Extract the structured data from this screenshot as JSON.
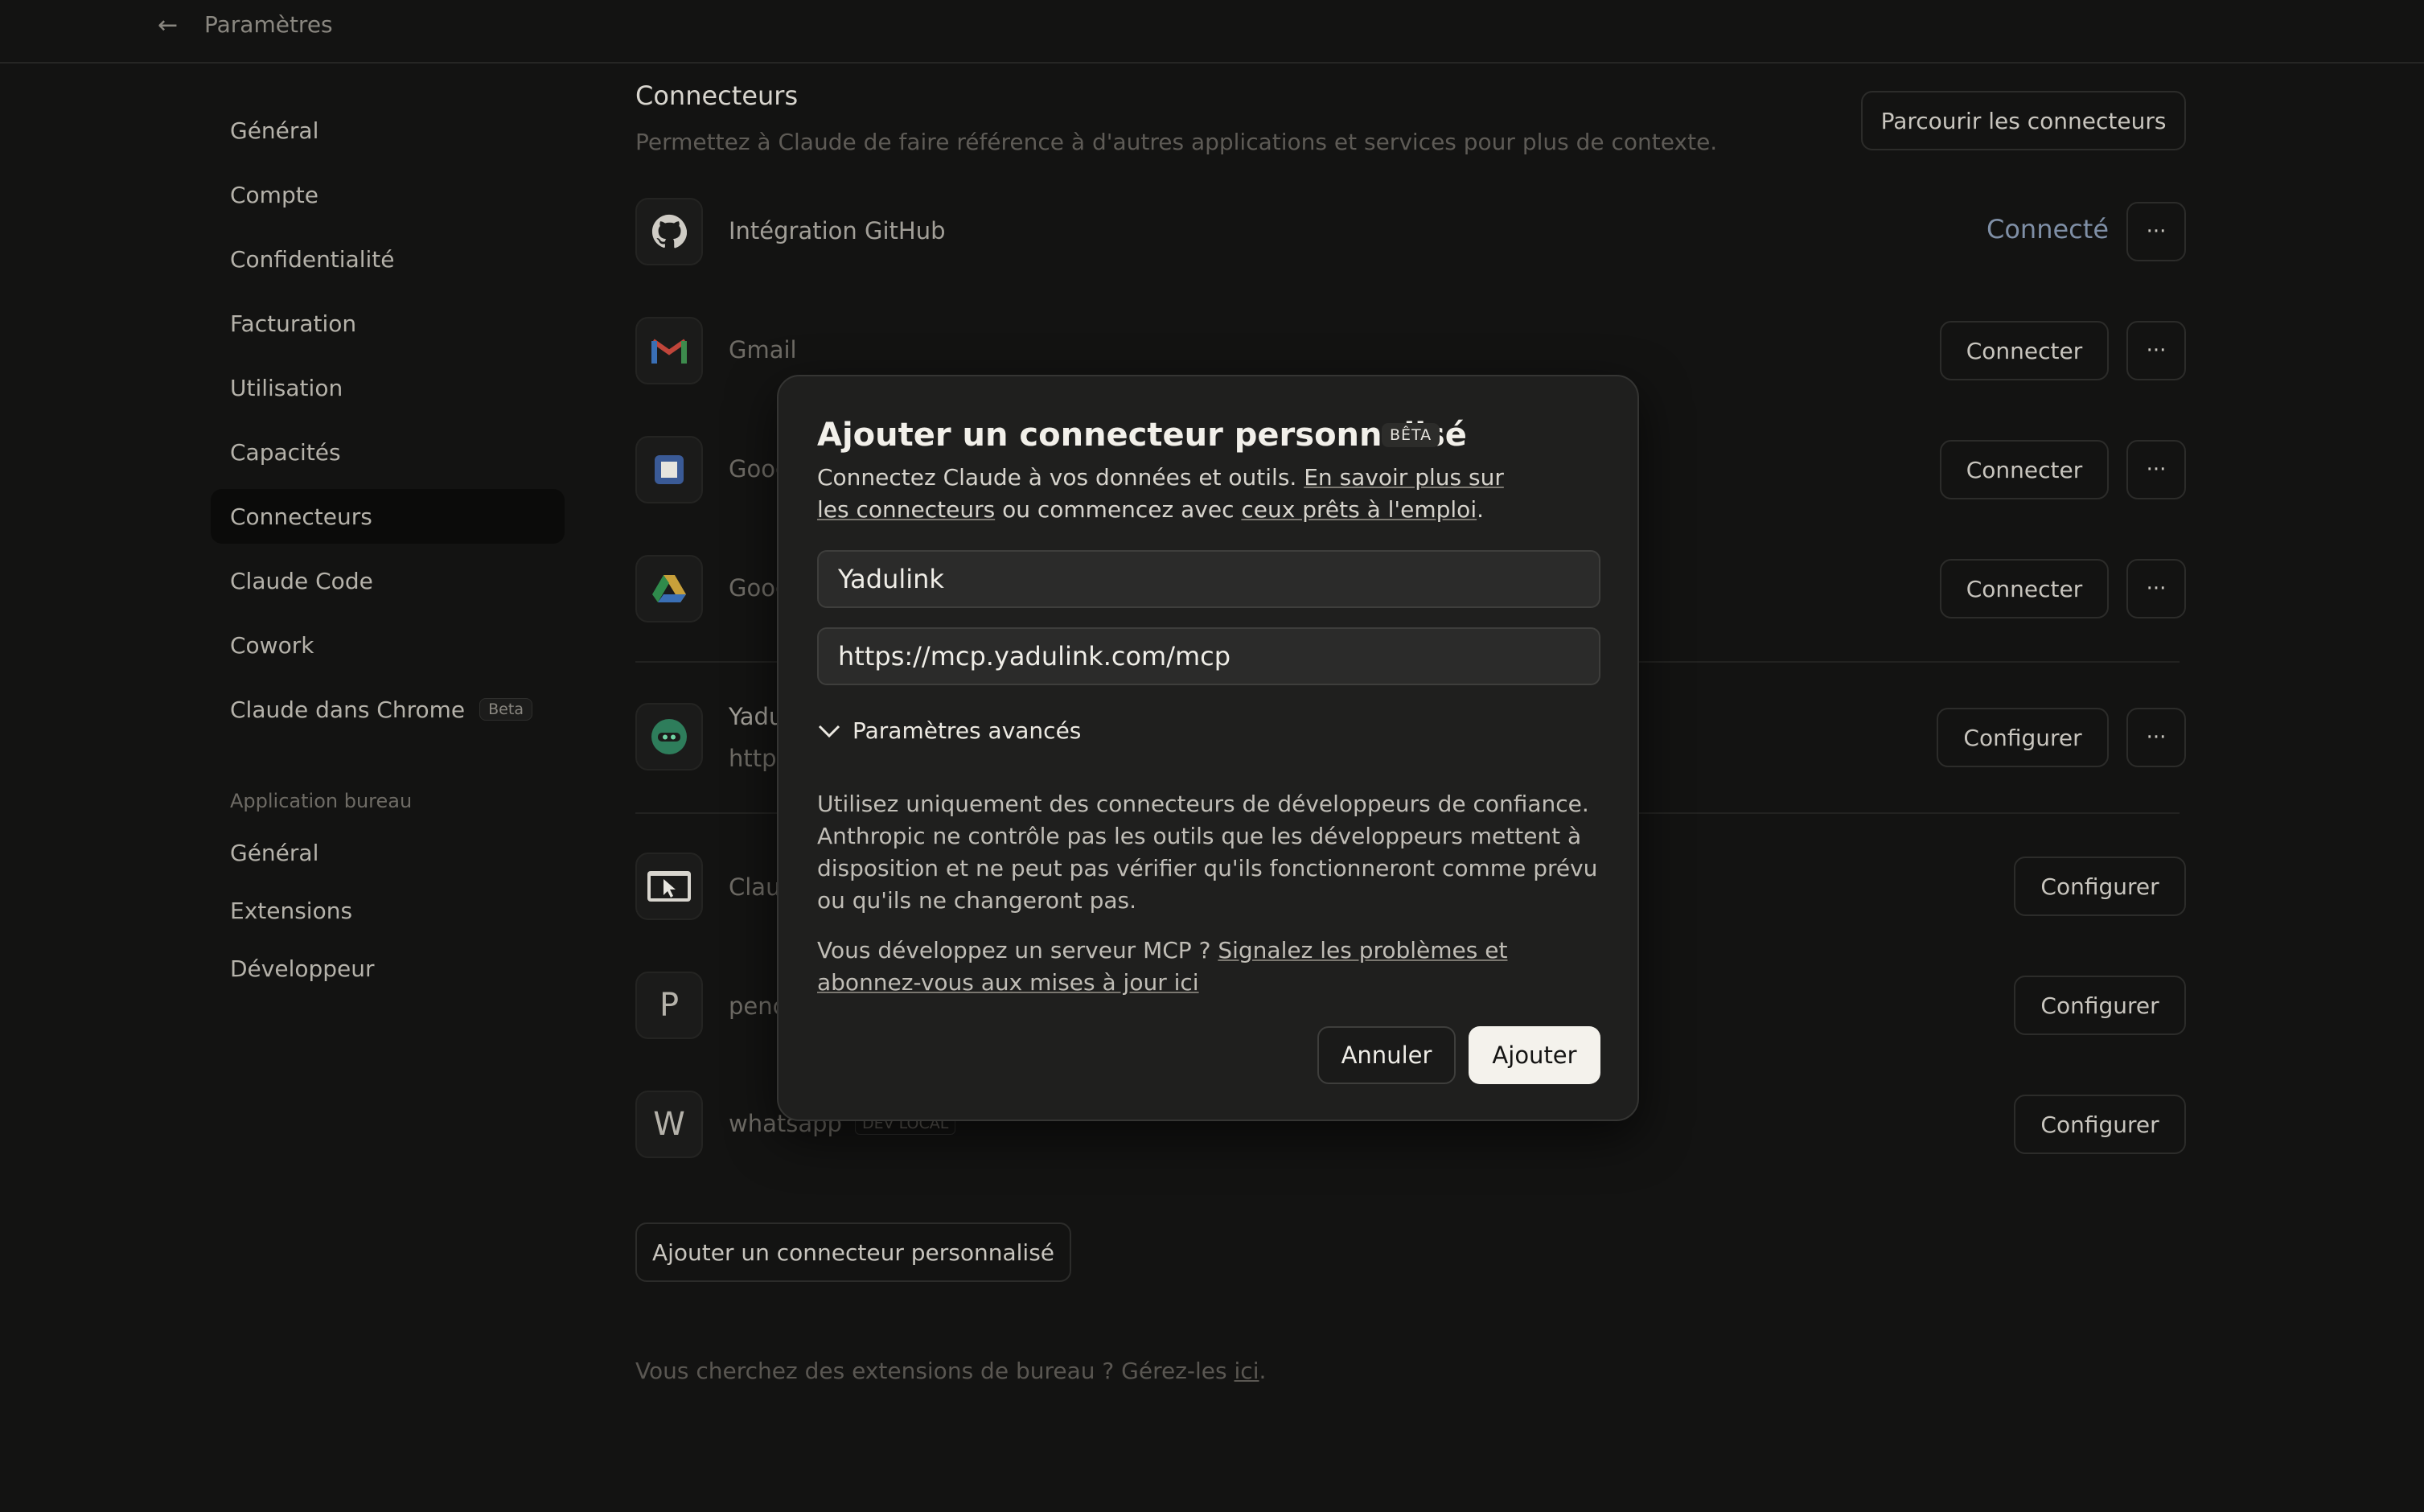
{
  "header": {
    "back_label": "Paramètres"
  },
  "sidebar": {
    "items": [
      {
        "label": "Général"
      },
      {
        "label": "Compte"
      },
      {
        "label": "Confidentialité"
      },
      {
        "label": "Facturation"
      },
      {
        "label": "Utilisation"
      },
      {
        "label": "Capacités"
      },
      {
        "label": "Connecteurs",
        "active": true
      },
      {
        "label": "Claude Code"
      },
      {
        "label": "Cowork"
      },
      {
        "label": "Claude dans Chrome",
        "badge": "Beta"
      }
    ],
    "section_title": "Application bureau",
    "desktop_items": [
      {
        "label": "Général"
      },
      {
        "label": "Extensions"
      },
      {
        "label": "Développeur"
      }
    ]
  },
  "main": {
    "title": "Connecteurs",
    "subtitle": "Permettez à Claude de faire référence à d'autres applications et services pour plus de contexte.",
    "browse_button": "Parcourir les connecteurs",
    "connectors": [
      {
        "name": "Intégration GitHub",
        "status": "Connecté",
        "icon": "github-icon"
      },
      {
        "name": "Gmail",
        "action": "Connecter",
        "icon": "gmail-icon"
      },
      {
        "name": "Goog",
        "action": "Connecter",
        "icon": "google-calendar-icon"
      },
      {
        "name": "Goog",
        "action": "Connecter",
        "icon": "google-drive-icon"
      },
      {
        "name": "Yadu",
        "url": "https",
        "action": "Configurer",
        "icon": "yadulink-icon"
      },
      {
        "name": "Clau",
        "action": "Configurer",
        "icon": "cursor-window-icon"
      },
      {
        "name": "penc",
        "action": "Configurer",
        "icon_letter": "P"
      },
      {
        "name": "whatsapp",
        "tag": "DEV LOCAL",
        "action": "Configurer",
        "icon_letter": "W"
      }
    ],
    "add_custom_button": "Ajouter un connecteur personnalisé",
    "footer_text": "Vous cherchez des extensions de bureau ? Gérez-les ",
    "footer_link": "ici",
    "footer_end": "."
  },
  "modal": {
    "title": "Ajouter un connecteur personnalisé",
    "beta": "BÊTA",
    "desc_prefix": "Connectez Claude à vos données et outils. ",
    "desc_link1": "En savoir plus sur les connecteurs",
    "desc_mid": " ou commencez avec ",
    "desc_link2": "ceux prêts à l'emploi",
    "desc_end": ".",
    "name_value": "Yadulink",
    "url_value": "https://mcp.yadulink.com/mcp",
    "advanced_label": "Paramètres avancés",
    "warning": "Utilisez uniquement des connecteurs de développeurs de confiance. Anthropic ne contrôle pas les outils que les développeurs mettent à disposition et ne peut pas vérifier qu'ils fonctionneront comme prévu ou qu'ils ne changeront pas.",
    "mcp_prefix": "Vous développez un serveur MCP ? ",
    "mcp_link": "Signalez les problèmes et abonnez-vous aux mises à jour ici",
    "cancel_label": "Annuler",
    "add_label": "Ajouter"
  }
}
